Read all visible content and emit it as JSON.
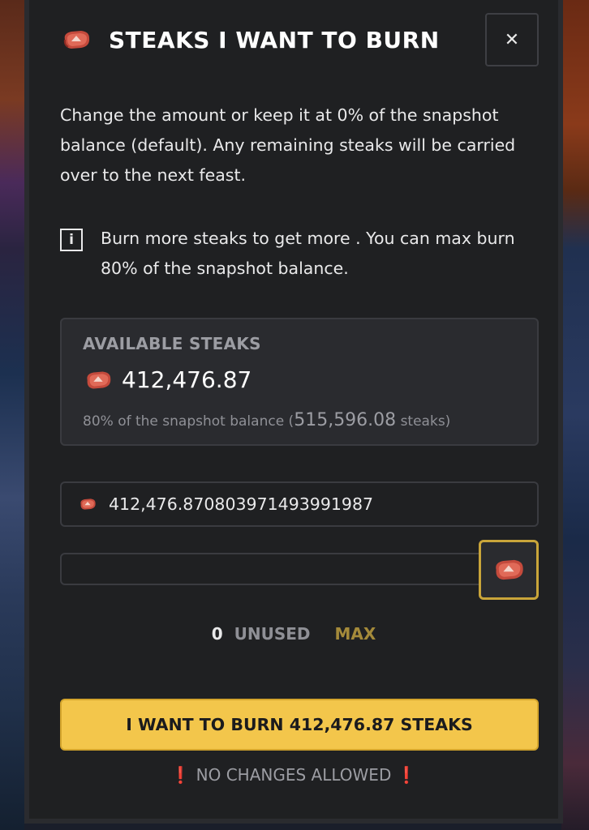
{
  "header": {
    "title": "STEAKS I WANT TO BURN",
    "close_symbol": "✕"
  },
  "description": "Change the amount or keep it at 0% of the snapshot balance (default). Any remaining steaks will be carried over to the next feast.",
  "info": {
    "icon_text": "i",
    "text": "Burn more steaks to get more . You can max burn 80% of the snapshot balance."
  },
  "available": {
    "label": "AVAILABLE STEAKS",
    "amount": "412,476.87",
    "sub_prefix": "80% of the snapshot balance (",
    "snapshot_balance": "515,596.08",
    "sub_suffix": " steaks)"
  },
  "input": {
    "value": "412,476.870803971493991987"
  },
  "slider": {
    "value_fraction": 1.0,
    "zero_label": "0",
    "unused_label": "UNUSED",
    "max_label": "MAX"
  },
  "burn_button": {
    "label": "I WANT TO BURN 412,476.87 STEAKS"
  },
  "warning": {
    "left": "❗",
    "text": "NO CHANGES ALLOWED",
    "right": "❗"
  },
  "colors": {
    "accent": "#f3c64b",
    "gold_border": "#c9a53a",
    "max_label": "#a48a3a",
    "warning_mark": "#e23a3a"
  },
  "icons": {
    "steak": "steak-icon",
    "close": "close-icon",
    "info": "info-icon"
  }
}
